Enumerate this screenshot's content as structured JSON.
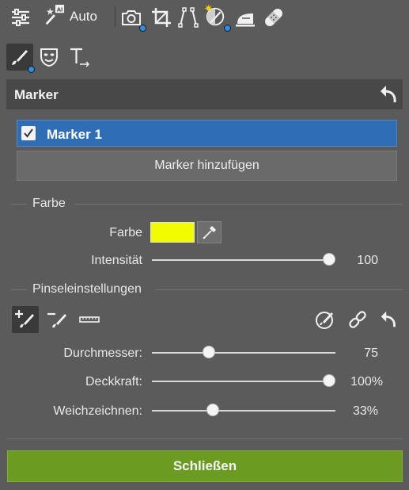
{
  "toolbar": {
    "auto_label": "Auto",
    "ai_badge": "AI",
    "icons": [
      "sliders-icon",
      "magic-wand-icon",
      "camera-icon",
      "crop-icon",
      "perspective-icon",
      "exposure-brush-icon",
      "iron-icon",
      "bandage-icon"
    ]
  },
  "panel": {
    "title": "Marker"
  },
  "markers": {
    "items": [
      {
        "label": "Marker 1",
        "checked": true
      }
    ],
    "add_button": "Marker hinzufügen"
  },
  "farbe_section": {
    "heading": "Farbe",
    "color_label": "Farbe",
    "color_value": "#f3fb00",
    "intensity_label": "Intensität",
    "intensity_value": "100",
    "intensity_level": 1.0
  },
  "brush_section": {
    "heading": "Pinseleinstellungen",
    "diameter_label": "Durchmesser:",
    "diameter_value": "75",
    "diameter_level": 0.31,
    "opacity_label": "Deckkraft:",
    "opacity_value": "100%",
    "opacity_level": 1.0,
    "softness_label": "Weichzeichnen:",
    "softness_value": "33%",
    "softness_level": 0.33
  },
  "close_button": "Schließen",
  "colors": {
    "accent_blue": "#2f6db5",
    "close_green": "#6c9b22",
    "swatch_yellow": "#f3fb00"
  }
}
